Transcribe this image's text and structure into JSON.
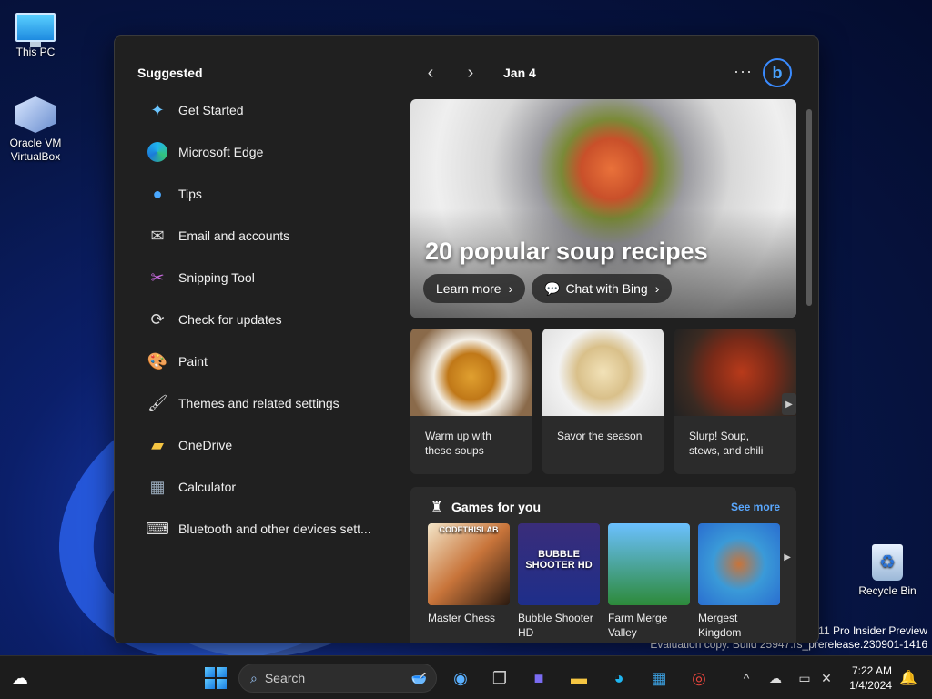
{
  "desktop": {
    "icons": [
      {
        "label": "This PC"
      },
      {
        "label": "Oracle VM VirtualBox"
      },
      {
        "label": "Recycle Bin"
      }
    ],
    "watermark": {
      "line1": "s 11 Pro Insider Preview",
      "line2": "Evaluation copy. Build 25947.rs_prerelease.230901-1416"
    }
  },
  "start_menu": {
    "suggested_title": "Suggested",
    "apps": [
      {
        "label": "Get Started",
        "icon": "get-started-icon"
      },
      {
        "label": "Microsoft Edge",
        "icon": "edge-icon"
      },
      {
        "label": "Tips",
        "icon": "tips-icon"
      },
      {
        "label": "Email and accounts",
        "icon": "mail-icon"
      },
      {
        "label": "Snipping Tool",
        "icon": "snipping-tool-icon"
      },
      {
        "label": "Check for updates",
        "icon": "refresh-icon"
      },
      {
        "label": "Paint",
        "icon": "paint-icon"
      },
      {
        "label": "Themes and related settings",
        "icon": "brush-icon"
      },
      {
        "label": "OneDrive",
        "icon": "onedrive-icon"
      },
      {
        "label": "Calculator",
        "icon": "calculator-icon"
      },
      {
        "label": "Bluetooth and other devices sett...",
        "icon": "devices-icon"
      }
    ],
    "widgets": {
      "date": "Jan 4",
      "hero": {
        "title": "20 popular soup recipes",
        "learn_more": "Learn more",
        "chat": "Chat with Bing"
      },
      "cards": [
        {
          "text": "Warm up with these soups"
        },
        {
          "text": "Savor the season"
        },
        {
          "text": "Slurp! Soup, stews, and chili"
        }
      ],
      "games": {
        "title": "Games for you",
        "see_more": "See more",
        "items": [
          {
            "label": "Master Chess",
            "tile_text": "CODETHISLAB"
          },
          {
            "label": "Bubble Shooter HD",
            "tile_text": "BUBBLE SHOOTER HD"
          },
          {
            "label": "Farm Merge Valley",
            "tile_text": ""
          },
          {
            "label": "Mergest Kingdom",
            "tile_text": ""
          }
        ]
      }
    }
  },
  "taskbar": {
    "search_placeholder": "Search",
    "time": "7:22 AM",
    "date": "1/4/2024"
  }
}
